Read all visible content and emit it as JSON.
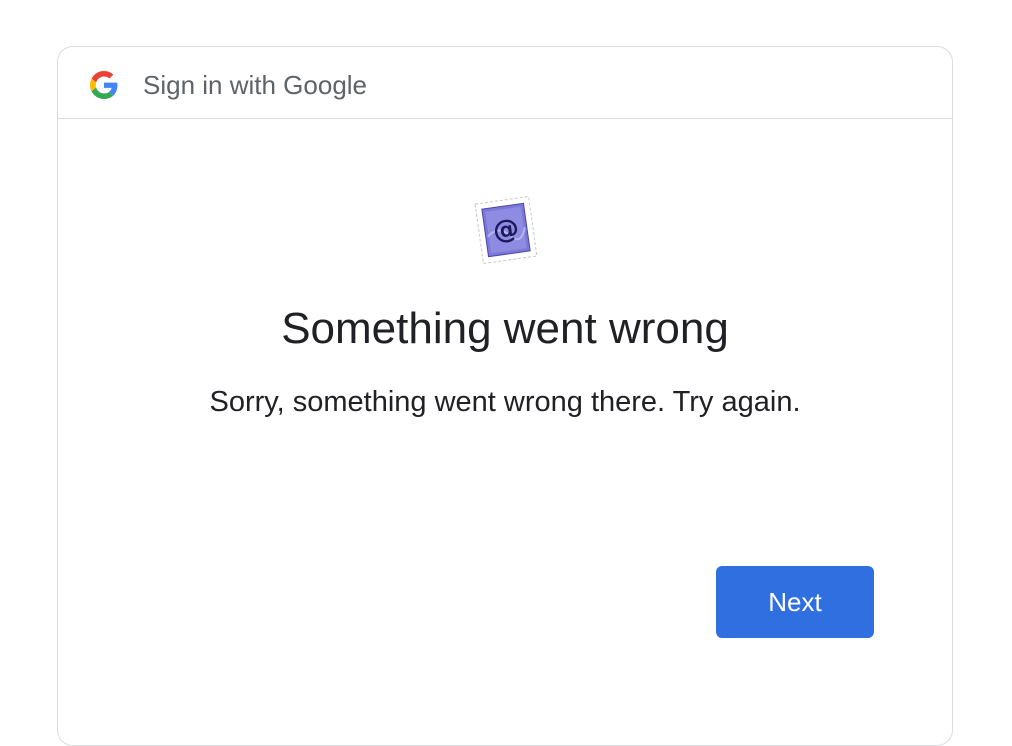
{
  "header": {
    "logo_icon": "google-g-icon",
    "title": "Sign in with Google"
  },
  "main": {
    "illustration_icon": "mail-stamp-icon",
    "title": "Something went wrong",
    "message": "Sorry, something went wrong there. Try again."
  },
  "actions": {
    "next_label": "Next"
  },
  "colors": {
    "primary_button": "#2f6fe0",
    "border": "#dadce0",
    "header_text": "#5f6368",
    "body_text": "#202124"
  }
}
